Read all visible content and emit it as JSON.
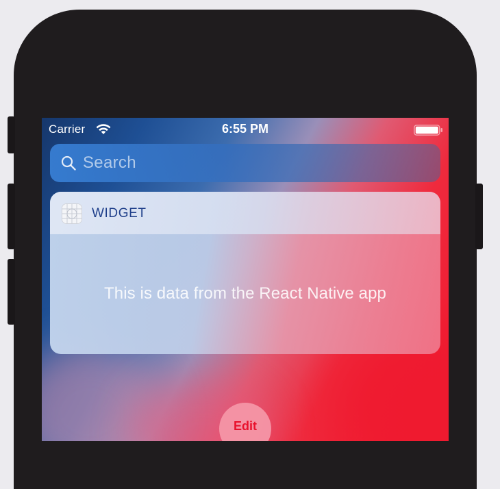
{
  "status_bar": {
    "carrier": "Carrier",
    "time": "6:55 PM",
    "icons": [
      "wifi-icon",
      "battery-icon"
    ]
  },
  "search": {
    "placeholder": "Search",
    "icon": "search-icon"
  },
  "widget": {
    "title": "WIDGET",
    "icon": "app-icon",
    "body_text": "This is data from the React Native app"
  },
  "footer": {
    "edit_label": "Edit"
  },
  "colors": {
    "accent_red": "#e8112d",
    "widget_title_blue": "#1f3f8a",
    "phone_frame": "#1f1c1e"
  }
}
